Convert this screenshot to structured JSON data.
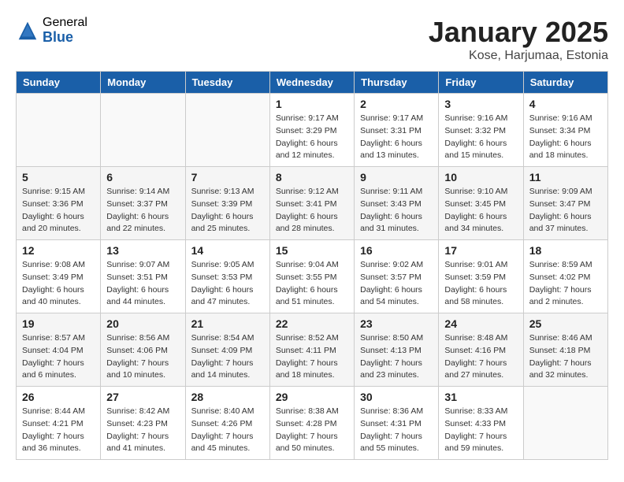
{
  "header": {
    "logo_general": "General",
    "logo_blue": "Blue",
    "month_title": "January 2025",
    "location": "Kose, Harjumaa, Estonia"
  },
  "days_of_week": [
    "Sunday",
    "Monday",
    "Tuesday",
    "Wednesday",
    "Thursday",
    "Friday",
    "Saturday"
  ],
  "weeks": [
    [
      {
        "day": "",
        "info": ""
      },
      {
        "day": "",
        "info": ""
      },
      {
        "day": "",
        "info": ""
      },
      {
        "day": "1",
        "info": "Sunrise: 9:17 AM\nSunset: 3:29 PM\nDaylight: 6 hours\nand 12 minutes."
      },
      {
        "day": "2",
        "info": "Sunrise: 9:17 AM\nSunset: 3:31 PM\nDaylight: 6 hours\nand 13 minutes."
      },
      {
        "day": "3",
        "info": "Sunrise: 9:16 AM\nSunset: 3:32 PM\nDaylight: 6 hours\nand 15 minutes."
      },
      {
        "day": "4",
        "info": "Sunrise: 9:16 AM\nSunset: 3:34 PM\nDaylight: 6 hours\nand 18 minutes."
      }
    ],
    [
      {
        "day": "5",
        "info": "Sunrise: 9:15 AM\nSunset: 3:36 PM\nDaylight: 6 hours\nand 20 minutes."
      },
      {
        "day": "6",
        "info": "Sunrise: 9:14 AM\nSunset: 3:37 PM\nDaylight: 6 hours\nand 22 minutes."
      },
      {
        "day": "7",
        "info": "Sunrise: 9:13 AM\nSunset: 3:39 PM\nDaylight: 6 hours\nand 25 minutes."
      },
      {
        "day": "8",
        "info": "Sunrise: 9:12 AM\nSunset: 3:41 PM\nDaylight: 6 hours\nand 28 minutes."
      },
      {
        "day": "9",
        "info": "Sunrise: 9:11 AM\nSunset: 3:43 PM\nDaylight: 6 hours\nand 31 minutes."
      },
      {
        "day": "10",
        "info": "Sunrise: 9:10 AM\nSunset: 3:45 PM\nDaylight: 6 hours\nand 34 minutes."
      },
      {
        "day": "11",
        "info": "Sunrise: 9:09 AM\nSunset: 3:47 PM\nDaylight: 6 hours\nand 37 minutes."
      }
    ],
    [
      {
        "day": "12",
        "info": "Sunrise: 9:08 AM\nSunset: 3:49 PM\nDaylight: 6 hours\nand 40 minutes."
      },
      {
        "day": "13",
        "info": "Sunrise: 9:07 AM\nSunset: 3:51 PM\nDaylight: 6 hours\nand 44 minutes."
      },
      {
        "day": "14",
        "info": "Sunrise: 9:05 AM\nSunset: 3:53 PM\nDaylight: 6 hours\nand 47 minutes."
      },
      {
        "day": "15",
        "info": "Sunrise: 9:04 AM\nSunset: 3:55 PM\nDaylight: 6 hours\nand 51 minutes."
      },
      {
        "day": "16",
        "info": "Sunrise: 9:02 AM\nSunset: 3:57 PM\nDaylight: 6 hours\nand 54 minutes."
      },
      {
        "day": "17",
        "info": "Sunrise: 9:01 AM\nSunset: 3:59 PM\nDaylight: 6 hours\nand 58 minutes."
      },
      {
        "day": "18",
        "info": "Sunrise: 8:59 AM\nSunset: 4:02 PM\nDaylight: 7 hours\nand 2 minutes."
      }
    ],
    [
      {
        "day": "19",
        "info": "Sunrise: 8:57 AM\nSunset: 4:04 PM\nDaylight: 7 hours\nand 6 minutes."
      },
      {
        "day": "20",
        "info": "Sunrise: 8:56 AM\nSunset: 4:06 PM\nDaylight: 7 hours\nand 10 minutes."
      },
      {
        "day": "21",
        "info": "Sunrise: 8:54 AM\nSunset: 4:09 PM\nDaylight: 7 hours\nand 14 minutes."
      },
      {
        "day": "22",
        "info": "Sunrise: 8:52 AM\nSunset: 4:11 PM\nDaylight: 7 hours\nand 18 minutes."
      },
      {
        "day": "23",
        "info": "Sunrise: 8:50 AM\nSunset: 4:13 PM\nDaylight: 7 hours\nand 23 minutes."
      },
      {
        "day": "24",
        "info": "Sunrise: 8:48 AM\nSunset: 4:16 PM\nDaylight: 7 hours\nand 27 minutes."
      },
      {
        "day": "25",
        "info": "Sunrise: 8:46 AM\nSunset: 4:18 PM\nDaylight: 7 hours\nand 32 minutes."
      }
    ],
    [
      {
        "day": "26",
        "info": "Sunrise: 8:44 AM\nSunset: 4:21 PM\nDaylight: 7 hours\nand 36 minutes."
      },
      {
        "day": "27",
        "info": "Sunrise: 8:42 AM\nSunset: 4:23 PM\nDaylight: 7 hours\nand 41 minutes."
      },
      {
        "day": "28",
        "info": "Sunrise: 8:40 AM\nSunset: 4:26 PM\nDaylight: 7 hours\nand 45 minutes."
      },
      {
        "day": "29",
        "info": "Sunrise: 8:38 AM\nSunset: 4:28 PM\nDaylight: 7 hours\nand 50 minutes."
      },
      {
        "day": "30",
        "info": "Sunrise: 8:36 AM\nSunset: 4:31 PM\nDaylight: 7 hours\nand 55 minutes."
      },
      {
        "day": "31",
        "info": "Sunrise: 8:33 AM\nSunset: 4:33 PM\nDaylight: 7 hours\nand 59 minutes."
      },
      {
        "day": "",
        "info": ""
      }
    ]
  ]
}
